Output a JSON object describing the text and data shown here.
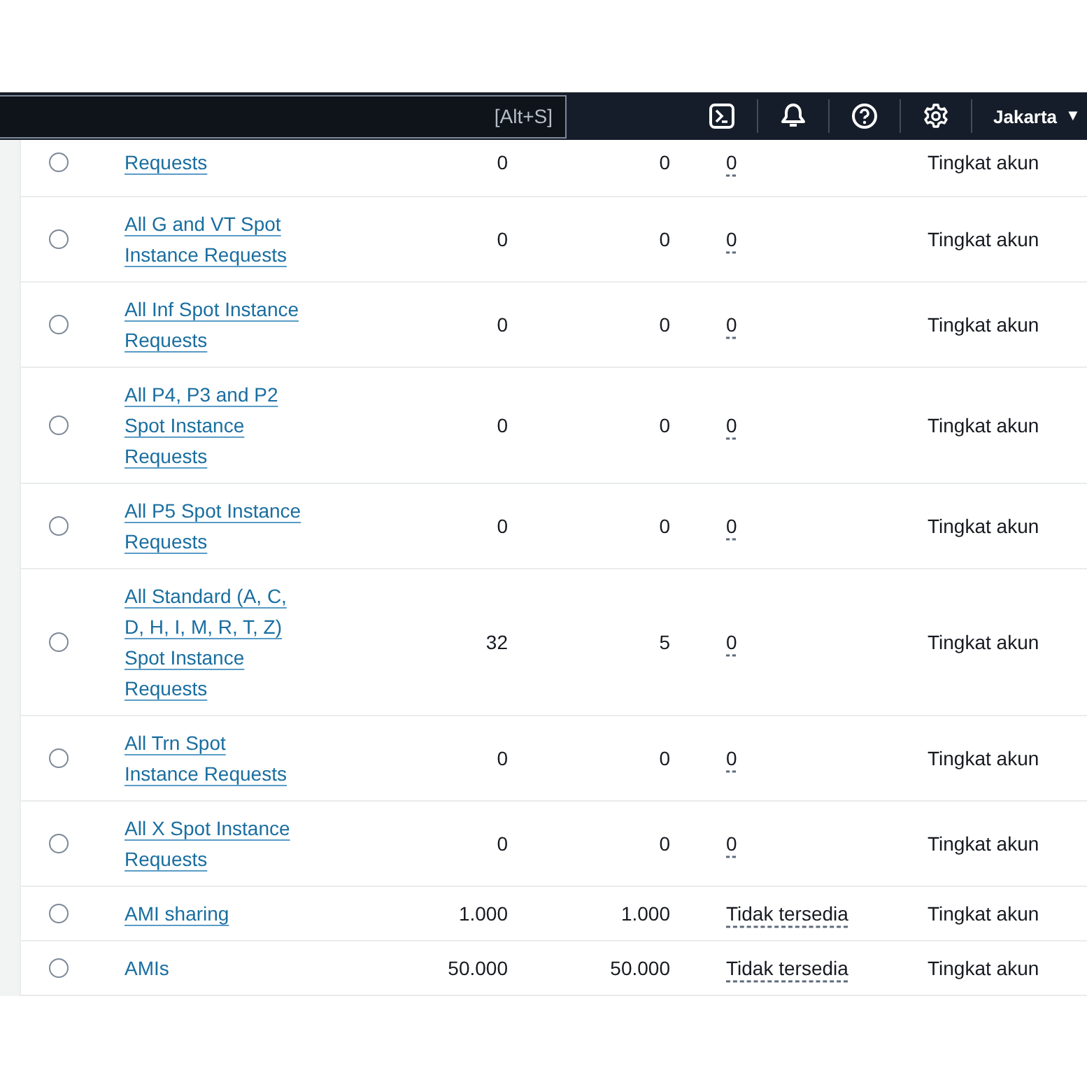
{
  "top_nav": {
    "search_shortcut": "[Alt+S]",
    "region": "Jakarta",
    "region_caret": "▼"
  },
  "rows": [
    {
      "selected": false,
      "name": "Requests",
      "underlined": true,
      "column_3": "0",
      "column_4": "0",
      "column_5": "0",
      "column_6": "Tingkat akun"
    },
    {
      "selected": false,
      "name": "All G and VT Spot Instance Requests",
      "underlined": true,
      "column_3": "0",
      "column_4": "0",
      "column_5": "0",
      "column_6": "Tingkat akun"
    },
    {
      "selected": false,
      "name": "All Inf Spot Instance Requests",
      "underlined": true,
      "column_3": "0",
      "column_4": "0",
      "column_5": "0",
      "column_6": "Tingkat akun"
    },
    {
      "selected": false,
      "name": "All P4, P3 and P2 Spot Instance Requests",
      "underlined": true,
      "column_3": "0",
      "column_4": "0",
      "column_5": "0",
      "column_6": "Tingkat akun"
    },
    {
      "selected": false,
      "name": "All P5 Spot Instance Requests",
      "underlined": true,
      "column_3": "0",
      "column_4": "0",
      "column_5": "0",
      "column_6": "Tingkat akun"
    },
    {
      "selected": false,
      "name": "All Standard (A, C, D, H, I, M, R, T, Z) Spot Instance Requests",
      "underlined": true,
      "column_3": "32",
      "column_4": "5",
      "column_5": "0",
      "column_6": "Tingkat akun"
    },
    {
      "selected": false,
      "name": "All Trn Spot Instance Requests",
      "underlined": true,
      "column_3": "0",
      "column_4": "0",
      "column_5": "0",
      "column_6": "Tingkat akun"
    },
    {
      "selected": false,
      "name": "All X Spot Instance Requests",
      "underlined": true,
      "column_3": "0",
      "column_4": "0",
      "column_5": "0",
      "column_6": "Tingkat akun"
    },
    {
      "selected": false,
      "name": "AMI sharing",
      "underlined": true,
      "column_3": "1.000",
      "column_4": "1.000",
      "column_5": "Tidak tersedia",
      "column_6": "Tingkat akun"
    },
    {
      "selected": false,
      "name": "AMIs",
      "underlined": false,
      "column_3": "50.000",
      "column_4": "50.000",
      "column_5": "Tidak tersedia",
      "column_6": "Tingkat akun"
    }
  ]
}
